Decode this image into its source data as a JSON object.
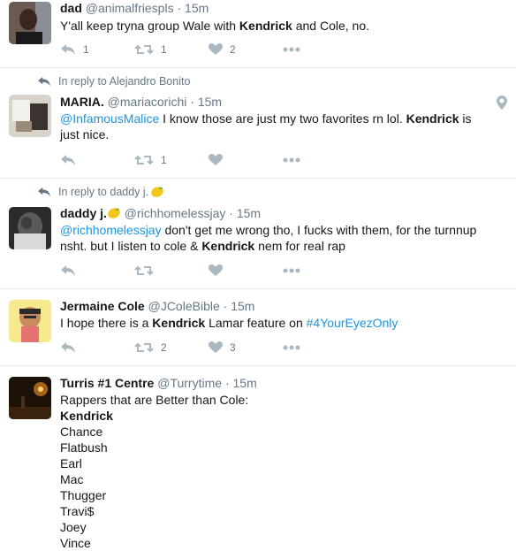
{
  "tweets": [
    {
      "name": "dad",
      "handle": "@animalfriespls",
      "time": "15m",
      "text": "Y'all keep tryna group Wale with ",
      "keyword": "Kendrick",
      "text_after": " and Cole, no.",
      "reply_count": "1",
      "retweet_count": "1",
      "like_count": "2"
    },
    {
      "context": "In reply to Alejandro Bonito",
      "name": "MARIA.",
      "handle": "@mariacorichi",
      "time": "15m",
      "mention": "@InfamousMalice",
      "text": " I know those are just my two favorites rn lol. ",
      "keyword": "Kendrick",
      "text_after": " is",
      "text_line2": "just nice.",
      "retweet_count": "1"
    },
    {
      "context": "In reply to daddy j.",
      "name": "daddy j.",
      "handle": "@richhomelessjay",
      "time": "15m",
      "mention": "@richhomelessjay",
      "text": " don't get me wrong tho, I fucks with them, for the turnnup",
      "text_line2_before": "nsht. but I listen to cole & ",
      "keyword": "Kendrick",
      "text_line2_after": " nem for real rap"
    },
    {
      "name": "Jermaine Cole",
      "handle": "@JColeBible",
      "time": "15m",
      "text": "I hope there is a ",
      "keyword": "Kendrick",
      "text_after": " Lamar feature on ",
      "hashtag": "#4YourEyezOnly",
      "retweet_count": "2",
      "like_count": "3"
    },
    {
      "name": "Turris #1 Centre",
      "handle": "@Turrytime",
      "time": "15m",
      "text": "Rappers that are Better than Cole:",
      "keyword": "Kendrick",
      "list": [
        "Chance",
        "Flatbush",
        "Earl",
        "Mac",
        "Thugger",
        "Travi$",
        "Joey",
        "Vince"
      ]
    }
  ],
  "separator": "·",
  "icons": {
    "reply": "reply-icon",
    "retweet": "retweet-icon",
    "like": "heart-icon",
    "more": "more-icon",
    "location": "location-pin-icon",
    "context": "reply-context-icon"
  },
  "colors": {
    "link": "#1b95e0",
    "muted": "#657786",
    "icon": "#aab8c2",
    "border": "#e6ecf0"
  }
}
